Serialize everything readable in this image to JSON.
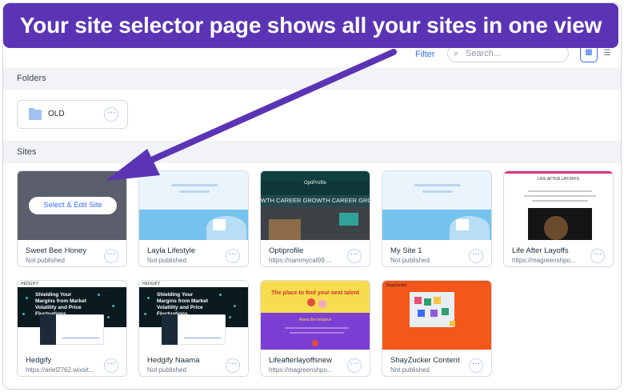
{
  "banner": {
    "text": "Your site selector page shows all your sites in one view"
  },
  "toolbar": {
    "filter_label": "Filter",
    "search_placeholder": "Search...",
    "search_icon": "search-icon",
    "grid_view_icon": "grid-view-icon",
    "list_view_icon": "list-view-icon"
  },
  "folders": {
    "heading": "Folders",
    "items": [
      {
        "name": "OLD"
      }
    ]
  },
  "sites": {
    "heading": "Sites",
    "hover_action": "Select & Edit Site",
    "items": [
      {
        "name": "Sweet Bee Honey",
        "status": "Not published"
      },
      {
        "name": "Layla Lifestyle",
        "status": "Not published"
      },
      {
        "name": "Optiprofile",
        "status": "https://nammycat99...."
      },
      {
        "name": "My Site 1",
        "status": "Not published"
      },
      {
        "name": "Life After Layoffs",
        "status": "https://magreenshpo..."
      },
      {
        "name": "Hedgify",
        "status": "https://ariel2762.wixsit..."
      },
      {
        "name": "Hedgify Naama",
        "status": "Not published"
      },
      {
        "name": "Lifeafterlayoffsnew",
        "status": "https://magreenshpo..."
      },
      {
        "name": "ShayZucker Content",
        "status": "Not published"
      }
    ]
  },
  "thumbnails": {
    "opti_strip": "WTH  CAREER GROWTH  CAREER GROWT",
    "opti_logo": "OptiProfile",
    "life_title": "LIFE AFTER LAYOFFS",
    "hedge_logo": "HEDGIFY",
    "hedge_headline": "Shielding Your Margins from Market Volatility and Price Fluctuations",
    "lfn_headline": "The place to find your next talent",
    "lfn_sub": "About the initiative",
    "shay_logo": "ShayZucker"
  },
  "colors": {
    "banner": "#5b34b5",
    "accent": "#3b6cf6",
    "arrow": "#5b34b5"
  }
}
